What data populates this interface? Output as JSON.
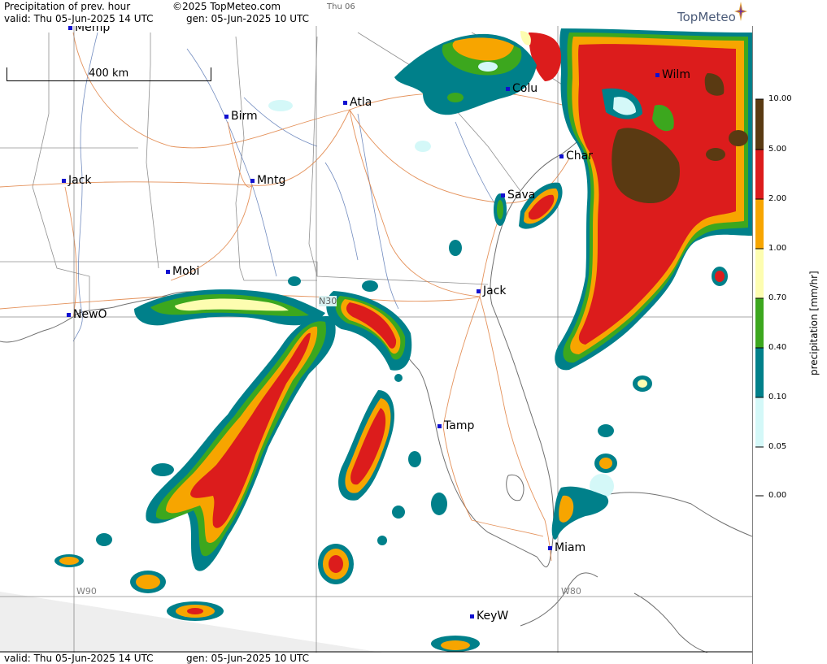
{
  "header": {
    "title": "Precipitation of prev. hour",
    "copyright": "©2025 TopMeteo.com",
    "day": "Thu 06",
    "valid": "valid:  Thu  05-Jun-2025  14 UTC",
    "gen": "gen:  05-Jun-2025 10 UTC"
  },
  "logo": {
    "text": "TopMeteo"
  },
  "scale": {
    "label": "400 km"
  },
  "grid_labels": {
    "w90": "W90",
    "w80": "W80",
    "n30": "N30"
  },
  "cities": [
    {
      "name": "Memp"
    },
    {
      "name": "Birm"
    },
    {
      "name": "Atla"
    },
    {
      "name": "Colu"
    },
    {
      "name": "Wilm"
    },
    {
      "name": "Jack"
    },
    {
      "name": "Mntg"
    },
    {
      "name": "Char"
    },
    {
      "name": "Sava"
    },
    {
      "name": "Mobi"
    },
    {
      "name": "Jack"
    },
    {
      "name": "NewO"
    },
    {
      "name": "Tamp"
    },
    {
      "name": "Miam"
    },
    {
      "name": "KeyW"
    }
  ],
  "legend": {
    "title": "precipitation  [mm/hr]",
    "levels": [
      "10.00",
      "5.00",
      "2.00",
      "1.00",
      "0.70",
      "0.40",
      "0.10",
      "0.05",
      "0.00"
    ],
    "colors": {
      "dark_brown": "#5a3a12",
      "red": "#dc1c1c",
      "orange": "#f7a500",
      "light_yellow": "#fdfdb0",
      "green": "#3ca71e",
      "teal": "#00808a",
      "light_cyan": "#d4f8f8"
    }
  },
  "footer": {
    "valid": "valid:  Thu  05-Jun-2025  14 UTC",
    "gen": "gen:  05-Jun-2025 10 UTC"
  }
}
